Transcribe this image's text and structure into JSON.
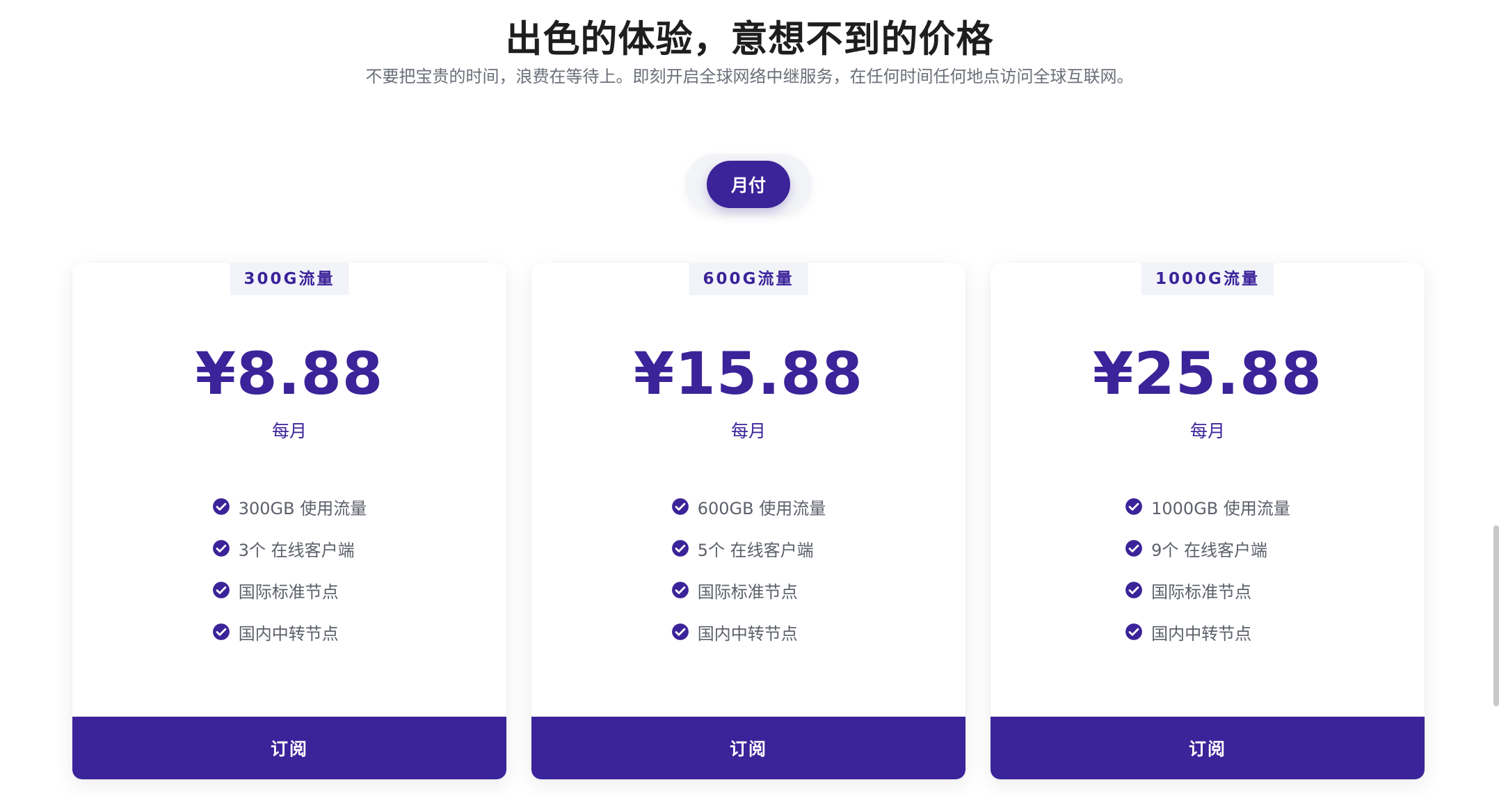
{
  "header": {
    "title": "出色的体验，意想不到的价格",
    "subtitle": "不要把宝贵的时间，浪费在等待上。即刻开启全球网络中继服务，在任何时间任何地点访问全球互联网。"
  },
  "billing_toggle": {
    "selected_label": "月付"
  },
  "colors": {
    "accent": "#3b2399",
    "text_dark": "#1e1e1e",
    "text_muted": "#5c606a",
    "tag_bg": "#f1f3f9"
  },
  "plans": [
    {
      "tag": "300G流量",
      "price": "¥8.88",
      "period": "每月",
      "features": [
        "300GB 使用流量",
        "3个 在线客户端",
        "国际标准节点",
        "国内中转节点"
      ],
      "button_label": "订阅"
    },
    {
      "tag": "600G流量",
      "price": "¥15.88",
      "period": "每月",
      "features": [
        "600GB 使用流量",
        "5个 在线客户端",
        "国际标准节点",
        "国内中转节点"
      ],
      "button_label": "订阅"
    },
    {
      "tag": "1000G流量",
      "price": "¥25.88",
      "period": "每月",
      "features": [
        "1000GB 使用流量",
        "9个 在线客户端",
        "国际标准节点",
        "国内中转节点"
      ],
      "button_label": "订阅"
    }
  ],
  "icons": {
    "feature_icon": "check-circle-icon"
  }
}
